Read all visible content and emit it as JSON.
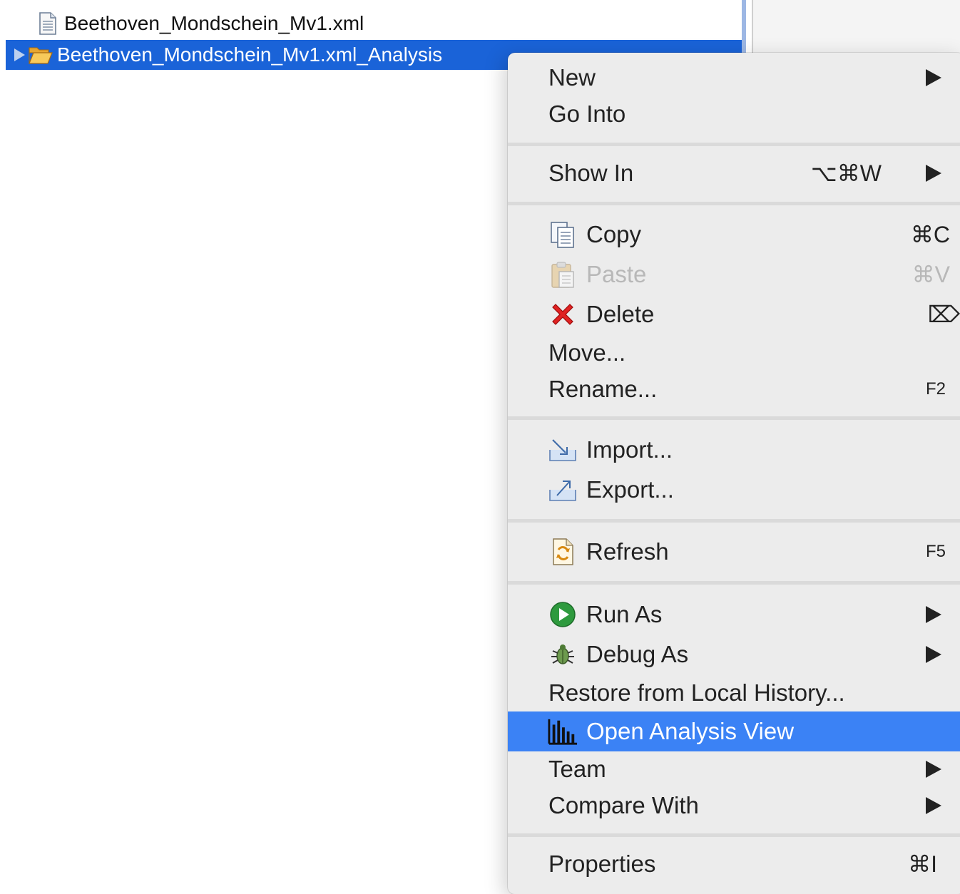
{
  "tree": {
    "items": [
      {
        "label": "Beethoven_Mondschein_Mv1.xml",
        "icon": "document-icon"
      },
      {
        "label": "Beethoven_Mondschein_Mv1.xml_Analysis",
        "icon": "folder-open-icon",
        "selected": true
      }
    ]
  },
  "menu": {
    "items": {
      "new": {
        "label": "New"
      },
      "go_into": {
        "label": "Go Into"
      },
      "show_in": {
        "label": "Show In",
        "shortcut": "⌥⌘W"
      },
      "copy": {
        "label": "Copy",
        "shortcut": "⌘C",
        "icon": "copy-icon"
      },
      "paste": {
        "label": "Paste",
        "shortcut": "⌘V",
        "icon": "paste-icon",
        "disabled": true
      },
      "delete": {
        "label": "Delete",
        "shortcut": "⌦",
        "icon": "delete-icon"
      },
      "move": {
        "label": "Move..."
      },
      "rename": {
        "label": "Rename...",
        "shortcut": "F2"
      },
      "import": {
        "label": "Import...",
        "icon": "import-icon"
      },
      "export": {
        "label": "Export...",
        "icon": "export-icon"
      },
      "refresh": {
        "label": "Refresh",
        "shortcut": "F5",
        "icon": "refresh-icon"
      },
      "run_as": {
        "label": "Run As",
        "icon": "run-icon"
      },
      "debug_as": {
        "label": "Debug As",
        "icon": "debug-icon"
      },
      "restore": {
        "label": "Restore from Local History..."
      },
      "open_analysis": {
        "label": "Open Analysis View",
        "icon": "bar-chart-icon",
        "highlighted": true
      },
      "team": {
        "label": "Team"
      },
      "compare_with": {
        "label": "Compare With"
      },
      "properties": {
        "label": "Properties",
        "shortcut": "⌘I"
      }
    }
  },
  "colors": {
    "selection": "#1a63d8",
    "menu_highlight": "#3b82f5",
    "menu_background": "#ececec"
  }
}
